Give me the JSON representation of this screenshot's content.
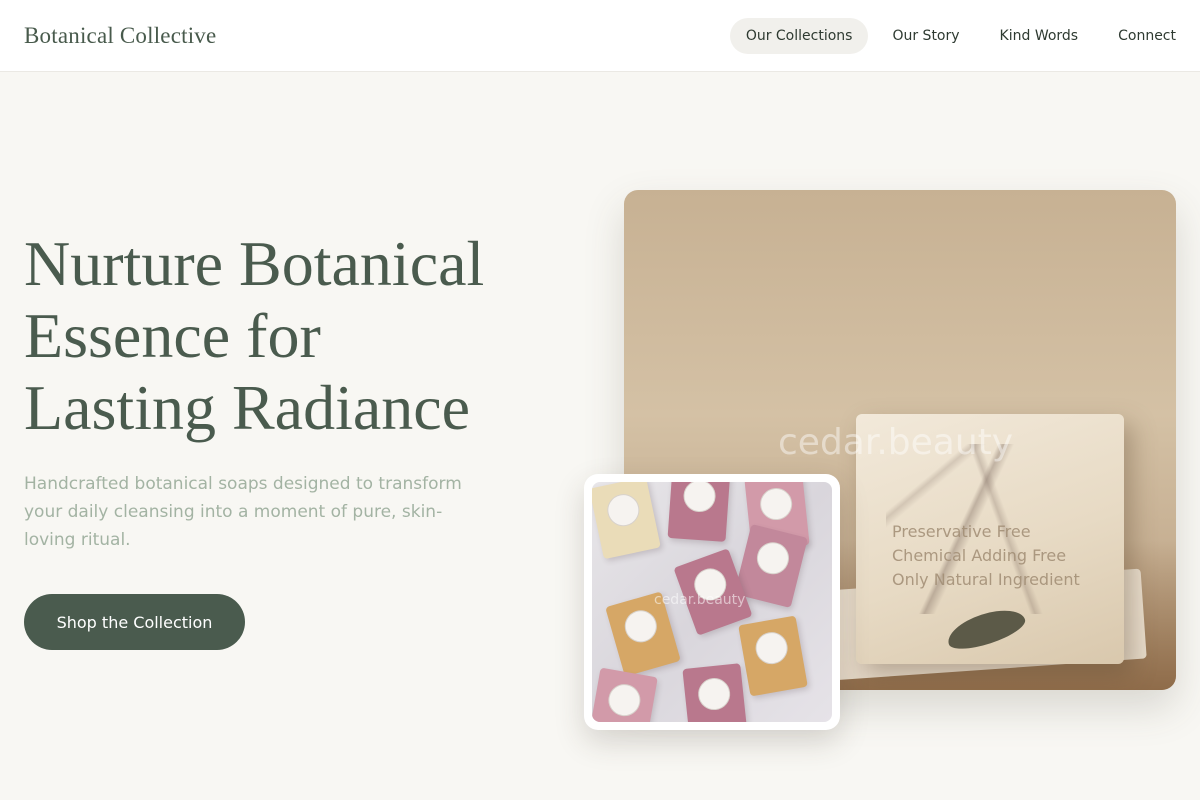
{
  "header": {
    "brand": "Botanical Collective",
    "nav": [
      {
        "label": "Our Collections",
        "active": true
      },
      {
        "label": "Our Story",
        "active": false
      },
      {
        "label": "Kind Words",
        "active": false
      },
      {
        "label": "Connect",
        "active": false
      }
    ]
  },
  "hero": {
    "title_lines": [
      "Nurture Botanical",
      "Essence for",
      "Lasting Radiance"
    ],
    "subtitle": "Handcrafted botanical soaps designed to transform your daily cleansing into a moment of pure, skin-loving ritual.",
    "cta_label": "Shop the Collection"
  },
  "main_image": {
    "watermark": "cedar.beauty",
    "box_text": [
      "Preservative Free",
      "Chemical Adding Free",
      "Only Natural Ingredient"
    ]
  },
  "thumb_image": {
    "watermark": "cedar.beauty"
  },
  "colors": {
    "background": "#f8f7f3",
    "accent": "#4a5b4e",
    "subtitle": "#a3b3a3"
  }
}
